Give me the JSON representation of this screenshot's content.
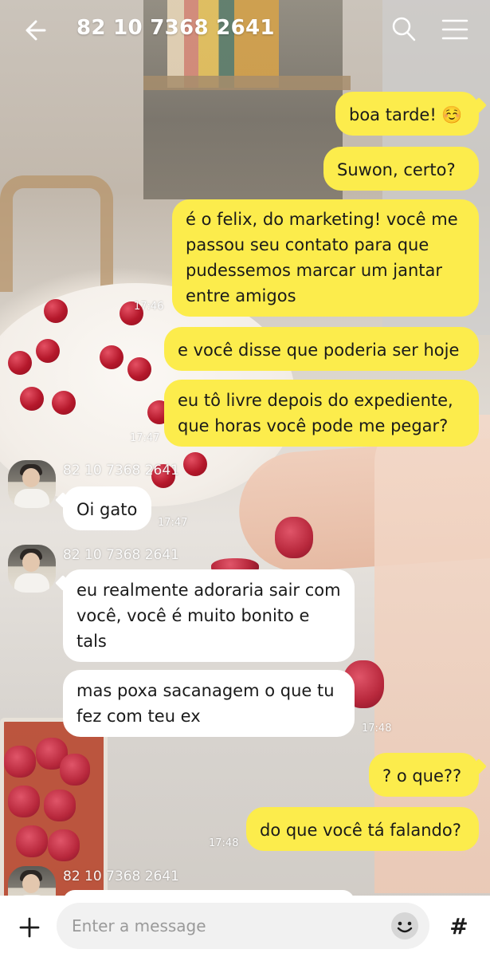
{
  "header": {
    "title": "82 10 7368 2641",
    "back_icon": "back-arrow-icon",
    "search_icon": "search-icon",
    "menu_icon": "hamburger-menu-icon"
  },
  "colors": {
    "my_bubble": "#fcec4c",
    "their_bubble": "#ffffff",
    "input_bg": "#f1f1f1"
  },
  "messages": {
    "m1": "boa tarde! ☺️",
    "m2": "Suwon, certo?",
    "m3_l1": "é o felix, do marketing! você me",
    "m3_l2": "passou seu contato para que",
    "m3_l3": "pudessemos marcar um jantar",
    "m3_l4": "entre amigos",
    "t1": "17:46",
    "m4": "e você disse que poderia ser hoje",
    "m5_l1": "eu tô livre depois do expediente,",
    "m5_l2": "que horas você pode me pegar?",
    "t2": "17:47",
    "sender1": "82 10 7368 2641",
    "r1": "Oi gato",
    "t3": "17:47",
    "sender2": "82 10 7368 2641",
    "r2_l1": "eu realmente adoraria sair com",
    "r2_l2": "você, você é muito bonito e",
    "r2_l3": "tals",
    "r3_l1": "mas poxa sacanagem o que tu",
    "r3_l2": "fez com teu ex",
    "t4": "17:48",
    "m6": "? o que??",
    "m7": "do que você tá falando?",
    "t5": "17:48",
    "sender3": "82 10 7368 2641"
  },
  "input": {
    "placeholder": "Enter a message",
    "plus_icon": "plus-icon",
    "emoji_icon": "emoji-icon",
    "hash_label": "#"
  }
}
